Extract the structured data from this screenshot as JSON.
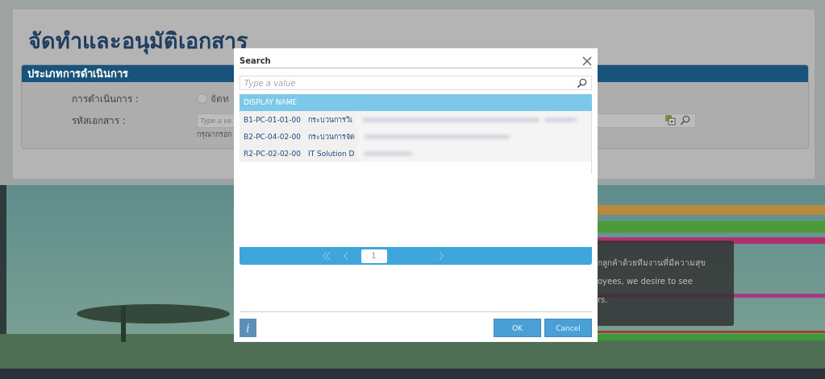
{
  "page": {
    "title": "จัดทำและอนุมัติเอกสาร",
    "section": {
      "header": "ประเภทการดำเนินการ",
      "fields": [
        {
          "kind": "radio",
          "label": "การดำเนินการ :",
          "option": "จัดท",
          "checked": false
        },
        {
          "kind": "input",
          "label": "รหัสเอกสาร :",
          "placeholder": "Type a va",
          "hint": "กรุณากรอก"
        }
      ]
    }
  },
  "banner": {
    "kind": "picture",
    "caption": [
      "กลูกค้าด้วยทีมงานที่มีความสุข",
      "oyees, we desire to see",
      "rs."
    ]
  },
  "dialog": {
    "title": "Search",
    "search": {
      "placeholder": "Type a value"
    },
    "table": {
      "columns": [
        "DISPLAY NAME"
      ],
      "rows": [
        {
          "code": "B1-PC-01-01-00",
          "name": "กระบวนการวิเ"
        },
        {
          "code": "B2-PC-04-02-00",
          "name": "กระบวนการจัด"
        },
        {
          "code": "R2-PC-02-02-00",
          "name": "IT Solution D"
        }
      ]
    },
    "pager": {
      "page": "1"
    },
    "info_button": "i",
    "buttons": [
      "OK",
      "Cancel"
    ]
  }
}
